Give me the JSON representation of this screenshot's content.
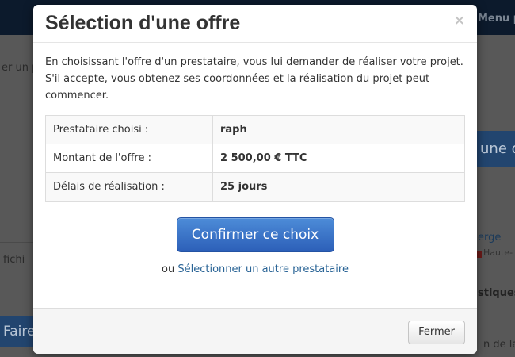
{
  "background": {
    "menu_label": "Menu pr",
    "text_left_1": "er un p",
    "text_left_2": "fichi",
    "cta_label": "une o",
    "link_text": "erge",
    "location_text": "Haute-",
    "bold_text": "stiques",
    "faire_label": "Faire",
    "text_bottom_right": "n de la"
  },
  "modal": {
    "title": "Sélection d'une offre",
    "close_symbol": "×",
    "intro": "En choisissant l'offre d'un prestataire, vous lui demander de réaliser votre projet. S'il accepte, vous obtenez ses coordonnées et la réalisation du projet peut commencer.",
    "table": [
      {
        "label": "Prestataire choisi :",
        "value": "raph"
      },
      {
        "label": "Montant de l'offre :",
        "value": "2 500,00 € TTC"
      },
      {
        "label": "Délais de réalisation :",
        "value": "25 jours"
      }
    ],
    "confirm_label": "Confirmer ce choix",
    "alt_prefix": "ou",
    "alt_link": "Sélectionner un autre prestataire",
    "close_label": "Fermer"
  }
}
